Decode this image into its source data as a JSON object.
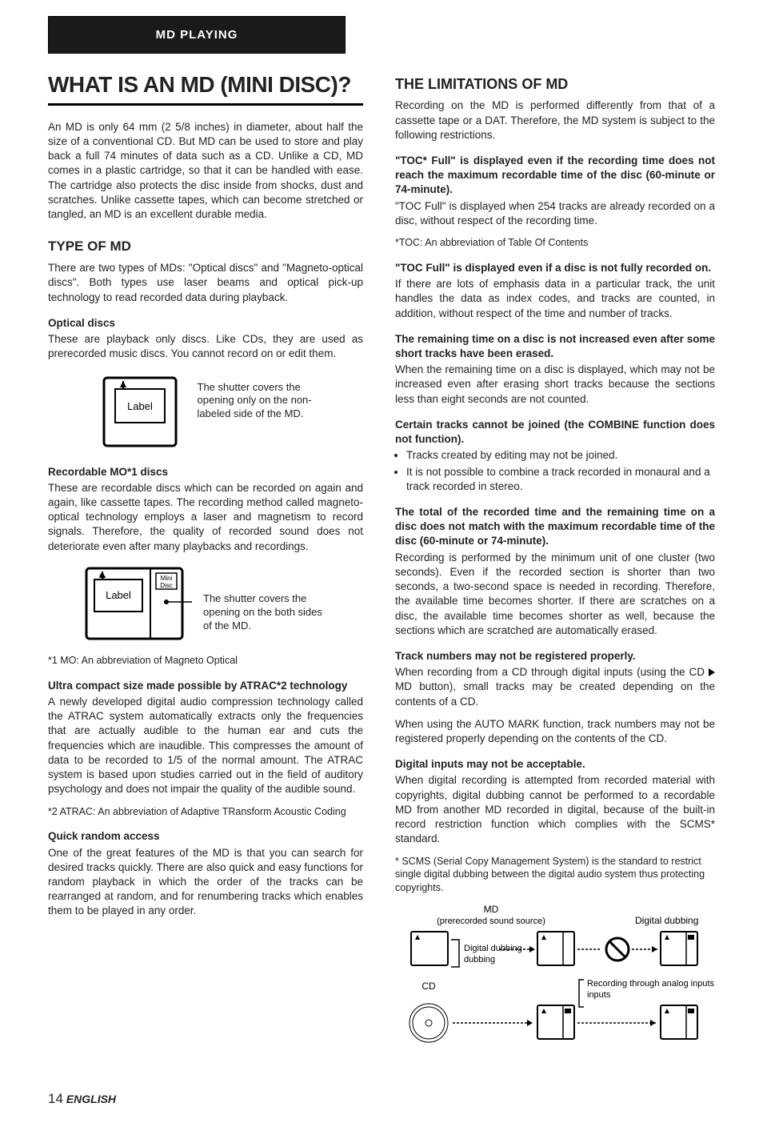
{
  "header_tab": "MD PLAYING",
  "left": {
    "title": "WHAT IS AN MD (MINI DISC)?",
    "intro": "An MD is only 64 mm (2 5/8 inches) in diameter, about half the size of a conventional CD. But MD can be used to store and play back a full 74 minutes of data such as a CD. Unlike a CD, MD comes in a plastic cartridge, so that it can be handled with ease. The cartridge also protects the disc inside from shocks, dust and scratches. Unlike cassette tapes, which can become stretched or tangled, an MD is an excellent durable media.",
    "type_heading": "TYPE OF MD",
    "type_intro": "There are two types of MDs: \"Optical discs\" and \"Magneto-optical discs\". Both types use laser beams and optical pick-up technology to read recorded data during playback.",
    "optical_heading": "Optical discs",
    "optical_body": "These are playback only discs. Like CDs, they are used as prerecorded music discs. You cannot record on or edit them.",
    "diag1_label": "Label",
    "diag1_caption": "The shutter covers the opening only on the non-labeled side of the MD.",
    "recordable_heading": "Recordable MO*1 discs",
    "recordable_body": "These are recordable discs which can be recorded on again and again, like cassette tapes. The recording method called magneto-optical technology employs a laser and magnetism to record signals. Therefore, the quality of recorded sound does not deteriorate even after many playbacks and recordings.",
    "diag2_label": "Label",
    "diag2_minidisc": "Mini\nDisc",
    "diag2_caption": "The shutter covers the opening on the both sides of the MD.",
    "footnote1": "*1 MO: An abbreviation of Magneto Optical",
    "atrac_heading": "Ultra compact size made possible by ATRAC*2 technology",
    "atrac_body": "A newly developed digital audio compression technology called the ATRAC system automatically extracts only the frequencies that are actually audible to the human ear and cuts the frequencies which are inaudible. This compresses the amount of data to be recorded to 1/5 of the normal amount. The ATRAC system is based upon studies carried out in the field of auditory psychology and does not impair the quality of the audible sound.",
    "footnote2": "*2 ATRAC: An abbreviation of Adaptive TRansform Acoustic Coding",
    "quick_heading": "Quick random access",
    "quick_body": "One of the great features of the MD is that you can search for desired tracks quickly. There are also quick and easy functions for random playback in which the order of the tracks can be rearranged at random, and for renumbering tracks which enables them to be played in any order."
  },
  "right": {
    "title": "THE LIMITATIONS OF MD",
    "intro": "Recording on the MD is performed differently from that of a cassette tape or a DAT. Therefore, the MD system is subject to the following restrictions.",
    "toc_full_heading": "\"TOC* Full\" is displayed even if the recording time does not reach the maximum recordable time of the disc (60-minute or 74-minute).",
    "toc_full_body": "\"TOC Full\" is displayed when 254 tracks are already recorded on a disc, without respect of the recording time.",
    "toc_note": "*TOC: An abbreviation of Table Of Contents",
    "toc_not_full_heading": "\"TOC Full\" is displayed even if a disc is not fully recorded on.",
    "toc_not_full_body": "If there are lots of emphasis data in a particular track, the unit handles the data as index codes, and tracks are counted, in addition, without respect of the time and number of tracks.",
    "remaining_heading": "The remaining time on a disc is not increased even after some short tracks have been erased.",
    "remaining_body": "When the remaining time on a disc is displayed, which may not be increased even after erasing short tracks because the sections less than eight seconds are not counted.",
    "combine_heading": "Certain tracks cannot be joined (the COMBINE function does not function).",
    "combine_bullets": [
      "Tracks created by editing may not be joined.",
      "It is not possible to combine a track recorded in monaural and a track recorded in stereo."
    ],
    "total_heading": "The total of the recorded time and the remaining time on a disc does not match with the maximum recordable time of the disc (60-minute or 74-minute).",
    "total_body": "Recording is performed by the minimum unit of one cluster (two seconds). Even if the recorded section is shorter than two seconds, a two-second space is needed in recording. Therefore, the available time becomes shorter. If there are scratches on a disc, the available time becomes shorter as well, because the sections which are scratched are automatically erased.",
    "track_heading": "Track numbers may not be registered properly.",
    "track_body1_prefix": "When recording from a CD through digital inputs (using the CD ",
    "track_body1_suffix": " MD button), small tracks may be created depending on the contents of a CD.",
    "track_body2": "When using the AUTO MARK function, track numbers may not be registered properly depending on the contents of the CD.",
    "digital_heading": "Digital inputs may not be acceptable.",
    "digital_body": "When digital recording is attempted from recorded material with copyrights, digital dubbing cannot be performed to a recordable MD from another MD recorded in digital, because of the built-in record restriction function which complies with the SCMS* standard.",
    "scms_note": "* SCMS (Serial Copy Management System) is the standard to restrict single digital dubbing between the digital audio system thus protecting copyrights.",
    "diag_md_label": "MD",
    "diag_md_sub": "(prerecorded sound source)",
    "diag_digital_dubbing": "Digital dubbing",
    "diag_digital_dubbing2": "Digital dubbing",
    "diag_cd": "CD",
    "diag_recording_analog": "Recording through analog inputs"
  },
  "footer": {
    "page": "14",
    "lang": "ENGLISH"
  }
}
